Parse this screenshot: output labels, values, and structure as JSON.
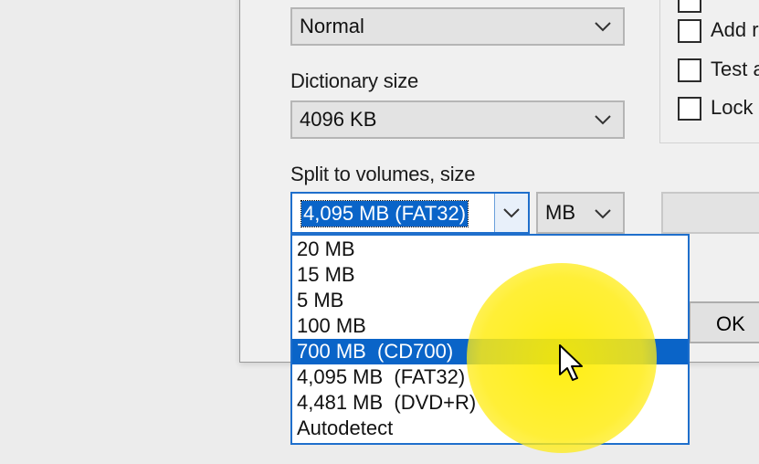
{
  "compression_level": {
    "value": "Normal"
  },
  "dictionary_size": {
    "label": "Dictionary size",
    "value": "4096 KB"
  },
  "split_volumes": {
    "label": "Split to volumes, size",
    "value": "4,095 MB  (FAT32)",
    "unit": "MB",
    "options": [
      "20 MB",
      "15 MB",
      "5 MB",
      "100 MB",
      "700 MB  (CD700)",
      "4,095 MB  (FAT32)",
      "4,481 MB  (DVD+R)",
      "Autodetect"
    ],
    "highlighted_index": 4
  },
  "options": {
    "add": "Add r",
    "test": "Test a",
    "lock": "Lock a"
  },
  "buttons": {
    "ok": "OK"
  },
  "colors": {
    "selection": "#0a64c8",
    "focus_border": "#1f6fcc",
    "highlighter": "#ffee00"
  },
  "icons": {
    "combo_arrow": "chevron-down-icon",
    "pointer": "mouse-cursor-icon"
  }
}
